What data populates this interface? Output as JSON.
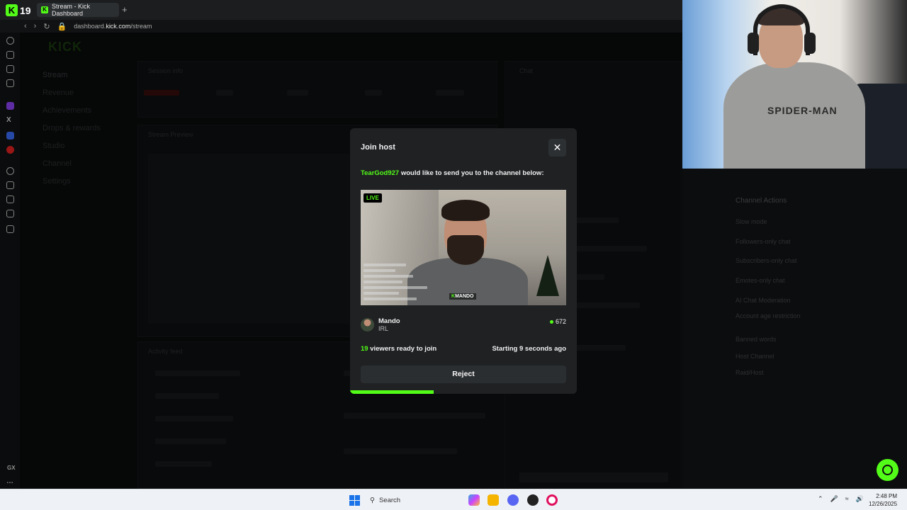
{
  "browser": {
    "badge_count": "19",
    "tab_title": "Stream - Kick Dashboard",
    "new_tab": "+",
    "url_prefix": "dashboard.",
    "url_domain": "kick.com",
    "url_path": "/stream",
    "sidebar_text": "GX"
  },
  "dashboard": {
    "logo": "KICK",
    "nav": [
      "Stream",
      "Revenue",
      "Achievements",
      "Drops & rewards",
      "Studio",
      "Channel",
      "Settings"
    ],
    "panels": {
      "session_info": "Session info",
      "stream_preview": "Stream Preview",
      "activity_feed": "Activity feed",
      "chat": "Chat"
    },
    "channel_actions": {
      "title": "Channel Actions",
      "items": [
        "Slow mode",
        "Followers-only chat",
        "Subscribers-only chat",
        "Emotes-only chat",
        "AI Chat Moderation",
        "Account age restriction",
        "Banned words",
        "Host Channel",
        "Raid/Host"
      ]
    }
  },
  "modal": {
    "title": "Join host",
    "close_icon": "close-icon",
    "requester": "TearGod927",
    "message": " would like to send you to the channel below:",
    "live_badge": "LIVE",
    "overlay_tag_prefix": "K",
    "overlay_tag": "MANDO",
    "channel_name": "Mando",
    "channel_category": "IRL",
    "viewer_count": "672",
    "ready_count": "19",
    "ready_text": " viewers ready to join",
    "starting_text": "Starting 9 seconds ago",
    "reject_label": "Reject",
    "countdown_progress": 0.37,
    "accent_color": "#53fc18"
  },
  "taskbar": {
    "search_label": "Search",
    "time": "2:48 PM",
    "date": "12/26/2025"
  }
}
